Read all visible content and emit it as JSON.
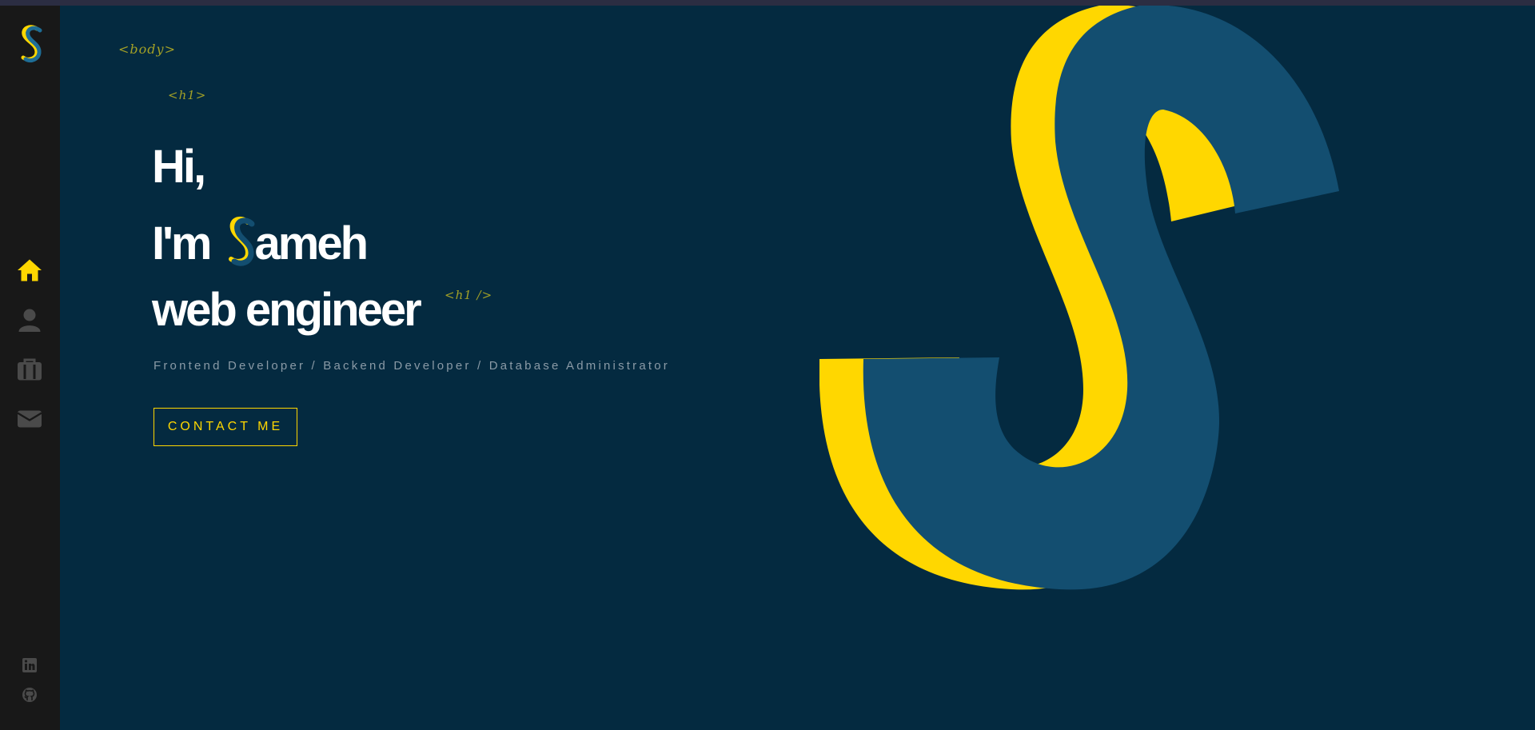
{
  "hero": {
    "line1": "Hi,",
    "line2_prefix": "I'm",
    "line2_suffix": "ameh",
    "line3": "web engineer",
    "subtitle": "Frontend Developer / Backend Developer / Database Administrator",
    "contact_label": "CONTACT ME"
  },
  "tags": {
    "body_open": "<body>",
    "h1_open": "<h1>",
    "h1_close": "<h1 />"
  },
  "sidebar": {
    "items": [
      {
        "name": "home",
        "icon": "home-icon",
        "active": true
      },
      {
        "name": "about",
        "icon": "user-icon",
        "active": false
      },
      {
        "name": "portfolio",
        "icon": "briefcase-icon",
        "active": false
      },
      {
        "name": "contact",
        "icon": "envelope-icon",
        "active": false
      }
    ],
    "social": [
      {
        "name": "linkedin",
        "icon": "linkedin-icon"
      },
      {
        "name": "github",
        "icon": "github-icon"
      }
    ]
  },
  "colors": {
    "accent": "#ffd700",
    "brand_blue": "#134e70",
    "background": "#042a40",
    "sidebar": "#181818"
  }
}
